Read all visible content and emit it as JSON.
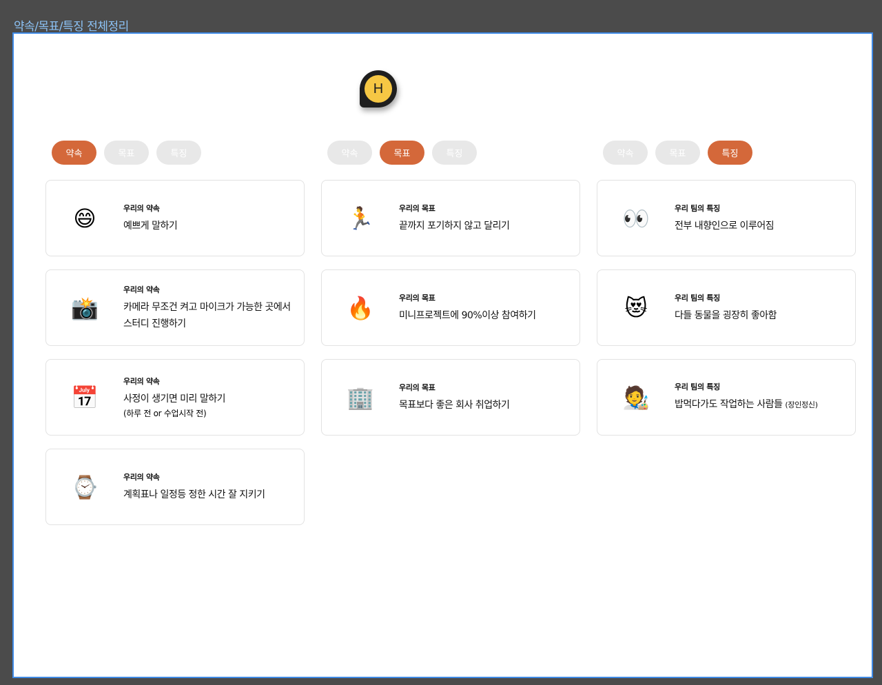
{
  "frame_title": "약속/목표/특징 전체정리",
  "logo": {
    "letter": "H",
    "colors": {
      "badge": "#1f1f1f",
      "inner": "#f6c744"
    }
  },
  "accent_color": "#d4683a",
  "columns": [
    {
      "tabs": [
        {
          "label": "약속",
          "active": true
        },
        {
          "label": "목표",
          "active": false
        },
        {
          "label": "특징",
          "active": false
        }
      ],
      "cards": [
        {
          "icon": "grinning-face-icon",
          "emoji": "😄",
          "label": "우리의 약속",
          "text": "예쁘게 말하기",
          "note": ""
        },
        {
          "icon": "camera-flash-icon",
          "emoji": "📸",
          "label": "우리의 약속",
          "text": "카메라 무조건 켜고 마이크가 가능한 곳에서 스터디 진행하기",
          "note": ""
        },
        {
          "icon": "calendar-icon",
          "emoji": "📅",
          "label": "우리의 약속",
          "text": "사정이 생기면 미리 말하기",
          "note": "(하루 전 or 수업시작 전)"
        },
        {
          "icon": "watch-icon",
          "emoji": "⌚",
          "label": "우리의 약속",
          "text": "계획표나 일정등 정한 시간 잘 지키기",
          "note": ""
        }
      ]
    },
    {
      "tabs": [
        {
          "label": "약속",
          "active": false
        },
        {
          "label": "목표",
          "active": true
        },
        {
          "label": "특징",
          "active": false
        }
      ],
      "cards": [
        {
          "icon": "running-person-icon",
          "emoji": "🏃",
          "label": "우리의 목표",
          "text": "끝까지 포기하지 않고 달리기",
          "note": ""
        },
        {
          "icon": "fire-icon",
          "emoji": "🔥",
          "label": "우리의 목표",
          "text": "미니프로젝트에 90%이상 참여하기",
          "note": ""
        },
        {
          "icon": "office-building-icon",
          "emoji": "🏢",
          "label": "우리의 목표",
          "text": "목표보다 좋은 회사 취업하기",
          "note": ""
        }
      ]
    },
    {
      "tabs": [
        {
          "label": "약속",
          "active": false
        },
        {
          "label": "목표",
          "active": false
        },
        {
          "label": "특징",
          "active": true
        }
      ],
      "cards": [
        {
          "icon": "eyes-icon",
          "emoji": "👀",
          "label": "우리 팀의 특징",
          "text": "전부 내향인으로 이루어짐",
          "note": ""
        },
        {
          "icon": "heart-eyes-cat-icon",
          "emoji": "😻",
          "label": "우리 팀의 특징",
          "text": "다들 동물을 굉장히 좋아함",
          "note": ""
        },
        {
          "icon": "artist-icon",
          "emoji": "🧑‍🎨",
          "label": "우리 팀의 특징",
          "text": "밥먹다가도 작업하는 사람들",
          "note": "(장인정신)"
        }
      ]
    }
  ]
}
